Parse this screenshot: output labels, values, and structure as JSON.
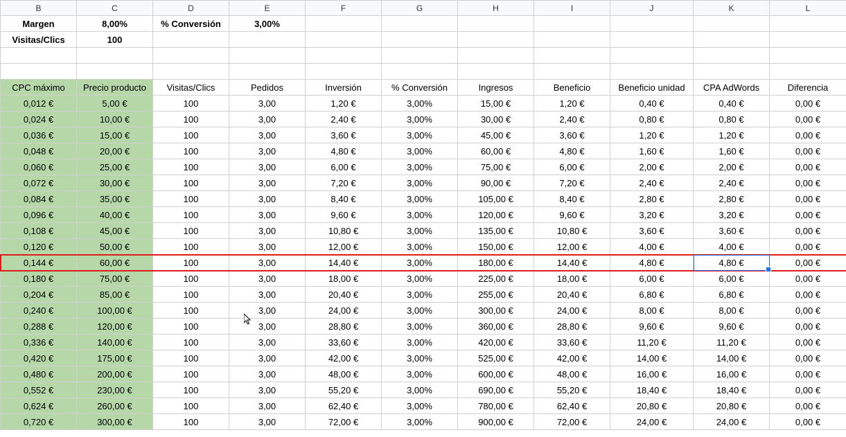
{
  "columns": [
    "B",
    "C",
    "D",
    "E",
    "F",
    "G",
    "H",
    "I",
    "J",
    "K",
    "L"
  ],
  "params": {
    "margen_label": "Margen",
    "margen_value": "8,00%",
    "conversion_h_label": "% Conversión",
    "conversion_h_value": "3,00%",
    "visitas_label": "Visitas/Clics",
    "visitas_value": "100"
  },
  "headers": {
    "b": "CPC máximo",
    "c": "Precio producto",
    "d": "Visitas/Clics",
    "e": "Pedidos",
    "f": "Inversión",
    "g": "% Conversión",
    "h": "Ingresos",
    "i": "Beneficio",
    "j": "Beneficio unidad",
    "k": "CPA AdWords",
    "l": "Diferencia"
  },
  "rows": [
    {
      "b": "0,012 €",
      "c": "5,00 €",
      "d": "100",
      "e": "3,00",
      "f": "1,20 €",
      "g": "3,00%",
      "h": "15,00 €",
      "i": "1,20 €",
      "j": "0,40 €",
      "k": "0,40 €",
      "l": "0,00 €"
    },
    {
      "b": "0,024 €",
      "c": "10,00 €",
      "d": "100",
      "e": "3,00",
      "f": "2,40 €",
      "g": "3,00%",
      "h": "30,00 €",
      "i": "2,40 €",
      "j": "0,80 €",
      "k": "0,80 €",
      "l": "0,00 €"
    },
    {
      "b": "0,036 €",
      "c": "15,00 €",
      "d": "100",
      "e": "3,00",
      "f": "3,60 €",
      "g": "3,00%",
      "h": "45,00 €",
      "i": "3,60 €",
      "j": "1,20 €",
      "k": "1,20 €",
      "l": "0,00 €"
    },
    {
      "b": "0,048 €",
      "c": "20,00 €",
      "d": "100",
      "e": "3,00",
      "f": "4,80 €",
      "g": "3,00%",
      "h": "60,00 €",
      "i": "4,80 €",
      "j": "1,60 €",
      "k": "1,60 €",
      "l": "0,00 €"
    },
    {
      "b": "0,060 €",
      "c": "25,00 €",
      "d": "100",
      "e": "3,00",
      "f": "6,00 €",
      "g": "3,00%",
      "h": "75,00 €",
      "i": "6,00 €",
      "j": "2,00 €",
      "k": "2,00 €",
      "l": "0,00 €"
    },
    {
      "b": "0,072 €",
      "c": "30,00 €",
      "d": "100",
      "e": "3,00",
      "f": "7,20 €",
      "g": "3,00%",
      "h": "90,00 €",
      "i": "7,20 €",
      "j": "2,40 €",
      "k": "2,40 €",
      "l": "0,00 €"
    },
    {
      "b": "0,084 €",
      "c": "35,00 €",
      "d": "100",
      "e": "3,00",
      "f": "8,40 €",
      "g": "3,00%",
      "h": "105,00 €",
      "i": "8,40 €",
      "j": "2,80 €",
      "k": "2,80 €",
      "l": "0,00 €"
    },
    {
      "b": "0,096 €",
      "c": "40,00 €",
      "d": "100",
      "e": "3,00",
      "f": "9,60 €",
      "g": "3,00%",
      "h": "120,00 €",
      "i": "9,60 €",
      "j": "3,20 €",
      "k": "3,20 €",
      "l": "0,00 €"
    },
    {
      "b": "0,108 €",
      "c": "45,00 €",
      "d": "100",
      "e": "3,00",
      "f": "10,80 €",
      "g": "3,00%",
      "h": "135,00 €",
      "i": "10,80 €",
      "j": "3,60 €",
      "k": "3,60 €",
      "l": "0,00 €"
    },
    {
      "b": "0,120 €",
      "c": "50,00 €",
      "d": "100",
      "e": "3,00",
      "f": "12,00 €",
      "g": "3,00%",
      "h": "150,00 €",
      "i": "12,00 €",
      "j": "4,00 €",
      "k": "4,00 €",
      "l": "0,00 €"
    },
    {
      "b": "0,144 €",
      "c": "60,00 €",
      "d": "100",
      "e": "3,00",
      "f": "14,40 €",
      "g": "3,00%",
      "h": "180,00 €",
      "i": "14,40 €",
      "j": "4,80 €",
      "k": "4,80 €",
      "l": "0,00 €"
    },
    {
      "b": "0,180 €",
      "c": "75,00 €",
      "d": "100",
      "e": "3,00",
      "f": "18,00 €",
      "g": "3,00%",
      "h": "225,00 €",
      "i": "18,00 €",
      "j": "6,00 €",
      "k": "6,00 €",
      "l": "0,00 €"
    },
    {
      "b": "0,204 €",
      "c": "85,00 €",
      "d": "100",
      "e": "3,00",
      "f": "20,40 €",
      "g": "3,00%",
      "h": "255,00 €",
      "i": "20,40 €",
      "j": "6,80 €",
      "k": "6,80 €",
      "l": "0,00 €"
    },
    {
      "b": "0,240 €",
      "c": "100,00 €",
      "d": "100",
      "e": "3,00",
      "f": "24,00 €",
      "g": "3,00%",
      "h": "300,00 €",
      "i": "24,00 €",
      "j": "8,00 €",
      "k": "8,00 €",
      "l": "0,00 €"
    },
    {
      "b": "0,288 €",
      "c": "120,00 €",
      "d": "100",
      "e": "3,00",
      "f": "28,80 €",
      "g": "3,00%",
      "h": "360,00 €",
      "i": "28,80 €",
      "j": "9,60 €",
      "k": "9,60 €",
      "l": "0,00 €"
    },
    {
      "b": "0,336 €",
      "c": "140,00 €",
      "d": "100",
      "e": "3,00",
      "f": "33,60 €",
      "g": "3,00%",
      "h": "420,00 €",
      "i": "33,60 €",
      "j": "11,20 €",
      "k": "11,20 €",
      "l": "0,00 €"
    },
    {
      "b": "0,420 €",
      "c": "175,00 €",
      "d": "100",
      "e": "3,00",
      "f": "42,00 €",
      "g": "3,00%",
      "h": "525,00 €",
      "i": "42,00 €",
      "j": "14,00 €",
      "k": "14,00 €",
      "l": "0,00 €"
    },
    {
      "b": "0,480 €",
      "c": "200,00 €",
      "d": "100",
      "e": "3,00",
      "f": "48,00 €",
      "g": "3,00%",
      "h": "600,00 €",
      "i": "48,00 €",
      "j": "16,00 €",
      "k": "16,00 €",
      "l": "0,00 €"
    },
    {
      "b": "0,552 €",
      "c": "230,00 €",
      "d": "100",
      "e": "3,00",
      "f": "55,20 €",
      "g": "3,00%",
      "h": "690,00 €",
      "i": "55,20 €",
      "j": "18,40 €",
      "k": "18,40 €",
      "l": "0,00 €"
    },
    {
      "b": "0,624 €",
      "c": "260,00 €",
      "d": "100",
      "e": "3,00",
      "f": "62,40 €",
      "g": "3,00%",
      "h": "780,00 €",
      "i": "62,40 €",
      "j": "20,80 €",
      "k": "20,80 €",
      "l": "0,00 €"
    },
    {
      "b": "0,720 €",
      "c": "300,00 €",
      "d": "100",
      "e": "3,00",
      "f": "72,00 €",
      "g": "3,00%",
      "h": "900,00 €",
      "i": "72,00 €",
      "j": "24,00 €",
      "k": "24,00 €",
      "l": "0,00 €"
    }
  ],
  "highlighted_row_index": 10,
  "selected_cell": {
    "row_index": 10,
    "col": "k"
  }
}
